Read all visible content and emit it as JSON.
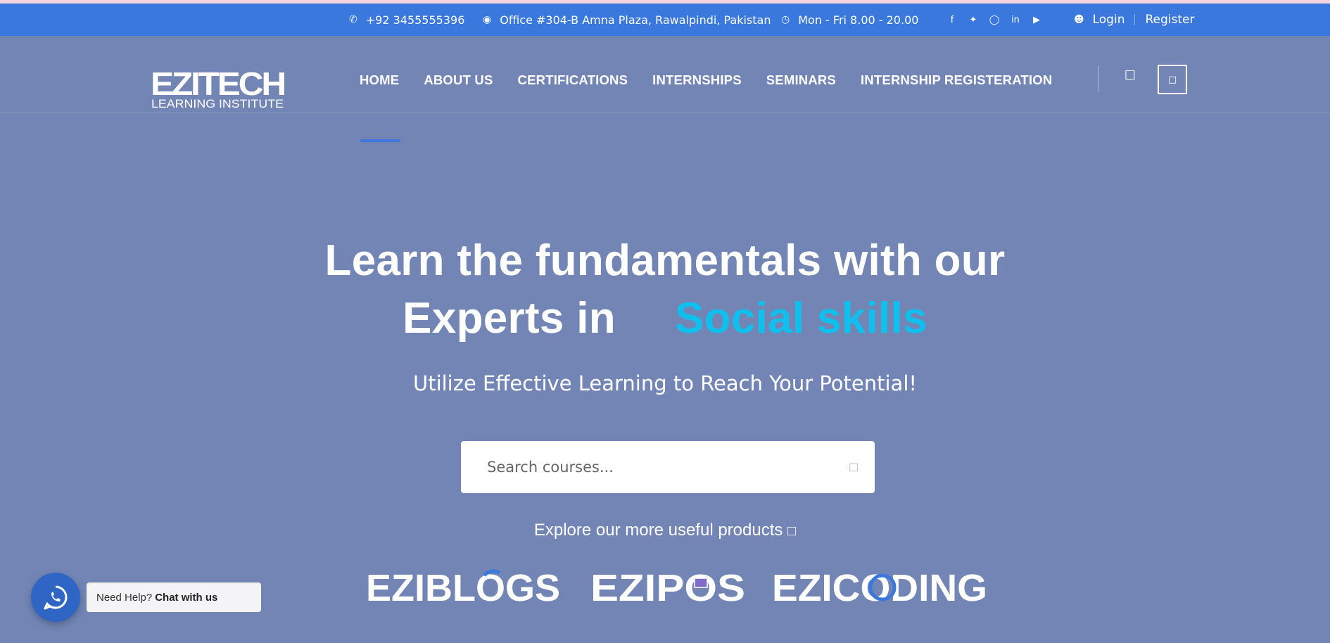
{
  "topbar": {
    "phone": "+92 3455555396",
    "address": "Office #304-B Amna Plaza, Rawalpindi, Pakistan",
    "hours": "Mon - Fri 8.00 - 20.00",
    "login": "Login",
    "register": "Register",
    "social_icons": [
      "facebook-icon",
      "twitter-icon",
      "instagram-icon",
      "linkedin-icon",
      "youtube-icon"
    ]
  },
  "logo": {
    "name": "EZITECH",
    "tagline": "LEARNING INSTITUTE"
  },
  "nav": {
    "items": [
      "HOME",
      "ABOUT US",
      "CERTIFICATIONS",
      "INTERNSHIPS",
      "SEMINARS",
      "INTERNSHIP REGISTERATION"
    ],
    "active": "HOME"
  },
  "hero": {
    "title_line1": "Learn the fundamentals with our",
    "title_line2": "Experts in",
    "title_accent": "Social skills",
    "subtitle": "Utilize Effective Learning to Reach Your Potential!",
    "search_placeholder": "Search courses..."
  },
  "explore": {
    "label": "Explore our more useful products"
  },
  "products": [
    "EZIBLOGS",
    "EZIPOS",
    "EZICODING"
  ],
  "chat": {
    "prefix": "Need Help?",
    "action": "Chat with us"
  },
  "colors": {
    "background": "#7285b5",
    "topbar": "#3a78de",
    "accent": "#0fc0ef",
    "active_underline": "#3a78de",
    "whatsapp": "#2f66c6"
  }
}
